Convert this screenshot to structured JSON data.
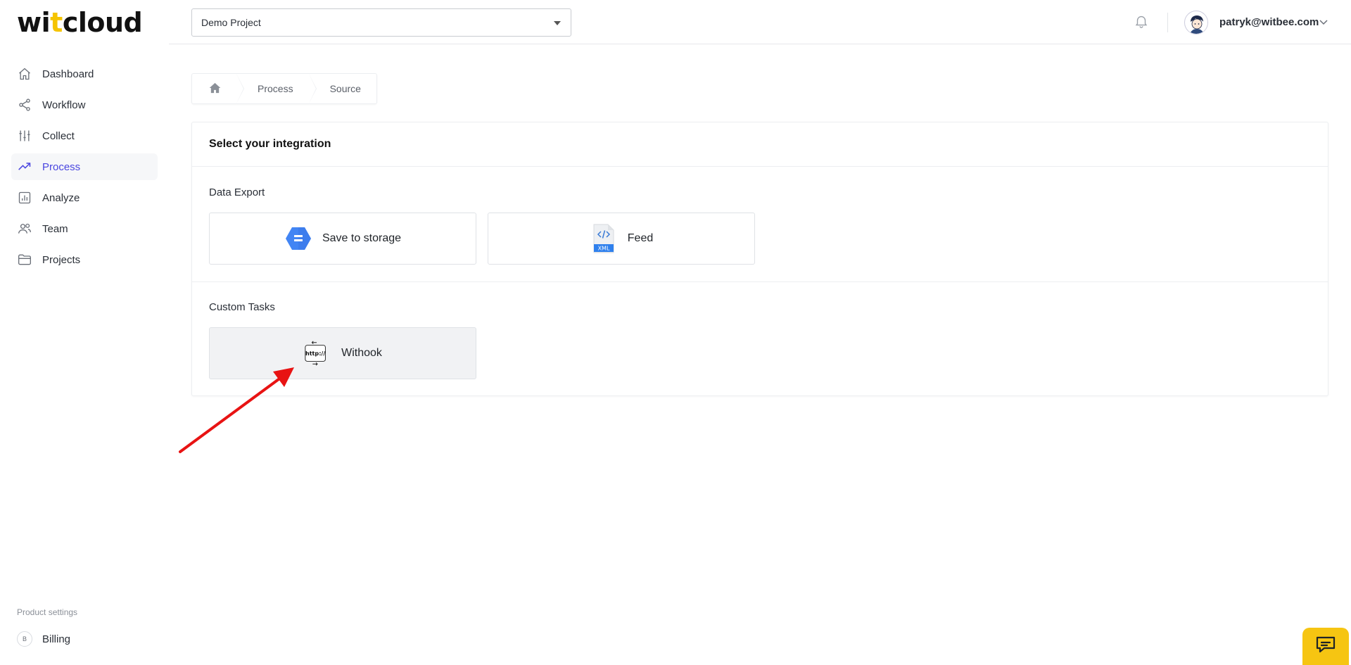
{
  "brand": {
    "logo_part1": "wi",
    "logo_accent": "t",
    "logo_part2": "cloud",
    "accent_color": "#f5c400"
  },
  "sidebar": {
    "items": [
      {
        "label": "Dashboard",
        "icon": "home-icon",
        "active": false
      },
      {
        "label": "Workflow",
        "icon": "share-icon",
        "active": false
      },
      {
        "label": "Collect",
        "icon": "sliders-icon",
        "active": false
      },
      {
        "label": "Process",
        "icon": "trending-up-icon",
        "active": true
      },
      {
        "label": "Analyze",
        "icon": "bar-chart-icon",
        "active": false
      },
      {
        "label": "Team",
        "icon": "users-icon",
        "active": false
      },
      {
        "label": "Projects",
        "icon": "folder-icon",
        "active": false
      }
    ],
    "product_settings": "Product settings",
    "billing": {
      "badge": "B",
      "label": "Billing"
    },
    "active_color": "#4a46e0"
  },
  "header": {
    "project": "Demo Project",
    "user_email": "patryk@witbee.com"
  },
  "breadcrumb": {
    "home_icon": "home-icon",
    "items": [
      "Process",
      "Source"
    ]
  },
  "card": {
    "title": "Select your integration",
    "sections": [
      {
        "title": "Data Export",
        "tiles": [
          {
            "label": "Save to storage",
            "icon": "cloud-storage-icon"
          },
          {
            "label": "Feed",
            "icon": "xml-file-icon",
            "badge": "XML"
          }
        ]
      },
      {
        "title": "Custom Tasks",
        "tiles": [
          {
            "label": "Withook",
            "icon": "webhook-http-icon",
            "icon_text": "http://"
          }
        ]
      }
    ]
  },
  "annotation": {
    "arrow_color": "#e81313"
  },
  "chat": {
    "icon": "chat-bubble-icon",
    "color": "#f6c512"
  }
}
